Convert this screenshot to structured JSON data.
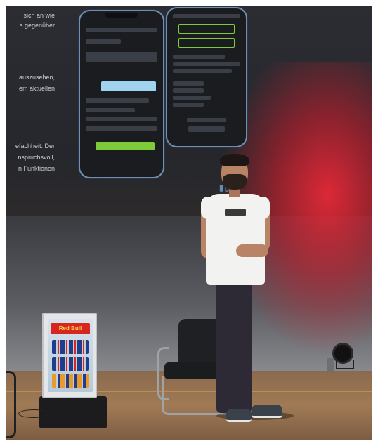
{
  "scene": {
    "description_free": true,
    "slide_lines": [
      "sich an wie",
      "s gegenüber",
      "auszusehen,",
      "em aktuellen",
      "efachheit. Der",
      "nspruchsvoll,",
      "n  Funktionen"
    ],
    "fridge_brand": "Red Bull",
    "colors": {
      "stage_red": "#e62837",
      "phone_accent": "#7ecb3a",
      "phone_border": "#6e8fb0"
    }
  }
}
